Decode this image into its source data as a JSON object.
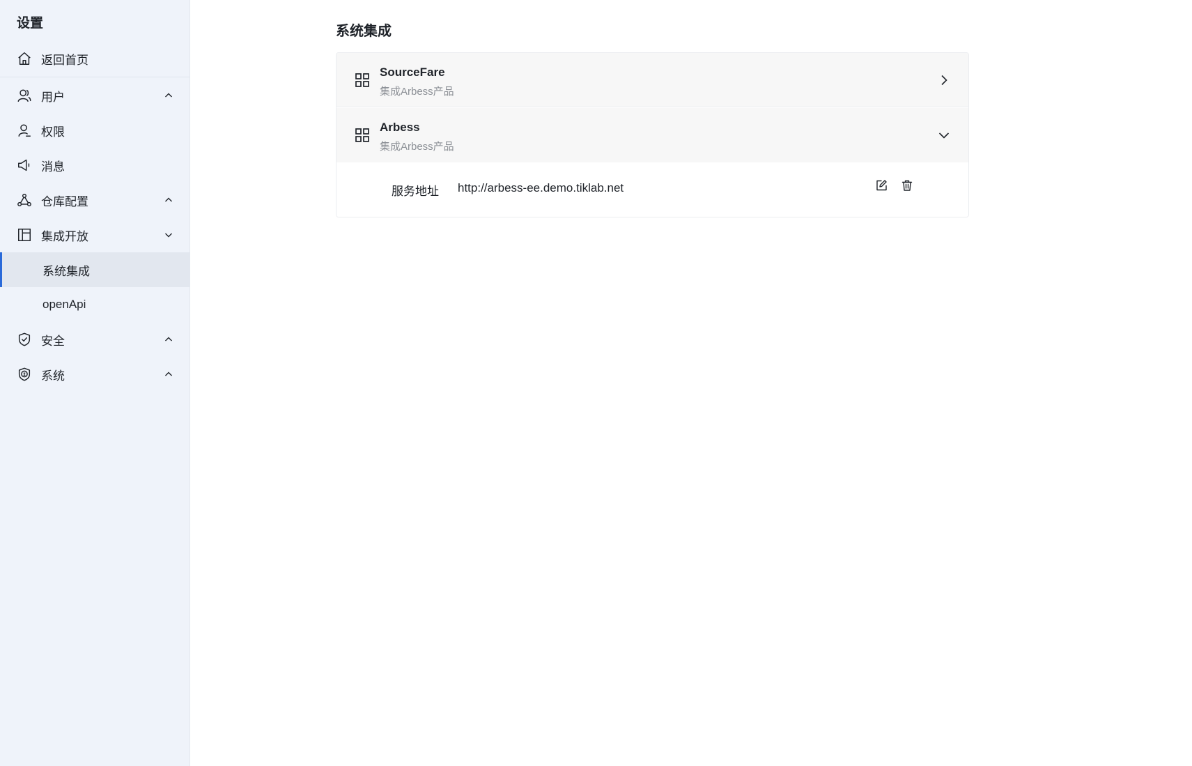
{
  "sidebar": {
    "title": "设置",
    "home": {
      "label": "返回首页",
      "icon": "home-icon"
    },
    "items": [
      {
        "label": "用户",
        "icon": "user-icon",
        "expanded": false
      },
      {
        "label": "权限",
        "icon": "permission-icon"
      },
      {
        "label": "消息",
        "icon": "megaphone-icon"
      },
      {
        "label": "仓库配置",
        "icon": "repository-icon",
        "expanded": false
      },
      {
        "label": "集成开放",
        "icon": "layout-icon",
        "expanded": true,
        "children": [
          {
            "label": "系统集成",
            "active": true
          },
          {
            "label": "openApi",
            "active": false
          }
        ]
      },
      {
        "label": "安全",
        "icon": "shield-check-icon",
        "expanded": false
      },
      {
        "label": "系统",
        "icon": "certificate-icon",
        "expanded": false
      }
    ]
  },
  "main": {
    "title": "系统集成",
    "integrations": [
      {
        "name": "SourceFare",
        "description": "集成Arbess产品",
        "icon": "grid-icon",
        "expanded": false
      },
      {
        "name": "Arbess",
        "description": "集成Arbess产品",
        "icon": "grid-icon",
        "expanded": true,
        "detail": {
          "label": "服务地址",
          "value": "http://arbess-ee.demo.tiklab.net",
          "actions": [
            "edit-icon",
            "delete-icon"
          ]
        }
      }
    ]
  },
  "colors": {
    "sidebar_bg": "#eff3fa",
    "active_bg": "#e2e7ef",
    "accent": "#2a6ad9",
    "row_bg": "#f7f7f7",
    "muted_text": "#8c9096"
  }
}
